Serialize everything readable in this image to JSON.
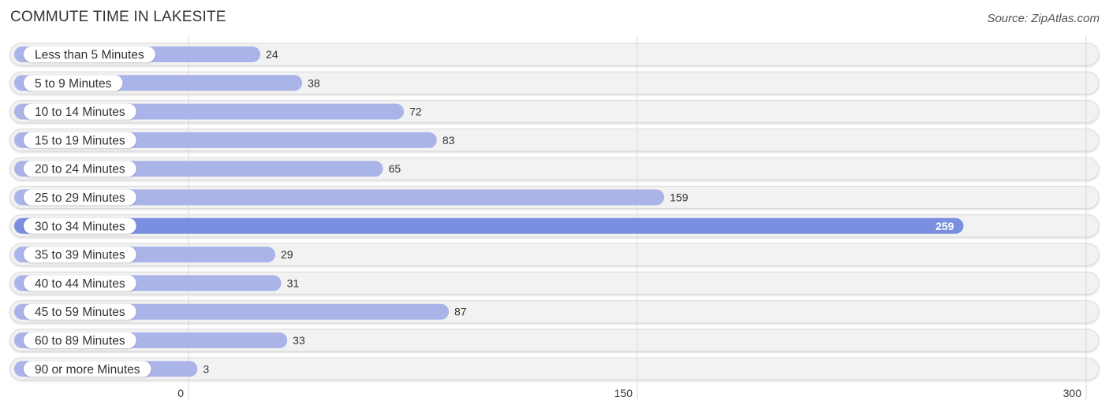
{
  "header": {
    "title": "COMMUTE TIME IN LAKESITE",
    "source": "Source: ZipAtlas.com"
  },
  "chart_data": {
    "type": "bar",
    "orientation": "horizontal",
    "title": "COMMUTE TIME IN LAKESITE",
    "xlabel": "",
    "ylabel": "",
    "categories": [
      "Less than 5 Minutes",
      "5 to 9 Minutes",
      "10 to 14 Minutes",
      "15 to 19 Minutes",
      "20 to 24 Minutes",
      "25 to 29 Minutes",
      "30 to 34 Minutes",
      "35 to 39 Minutes",
      "40 to 44 Minutes",
      "45 to 59 Minutes",
      "60 to 89 Minutes",
      "90 or more Minutes"
    ],
    "values": [
      24,
      38,
      72,
      83,
      65,
      159,
      259,
      29,
      31,
      87,
      33,
      3
    ],
    "xlim": [
      0,
      300
    ],
    "xticks": [
      0,
      150,
      300
    ],
    "grid": true,
    "highlight_index": 6,
    "colors": {
      "bar": "#aab4e8",
      "bar_highlight": "#7b8fe0",
      "track": "#f2f2f2",
      "track_border": "#dcdcdc"
    }
  }
}
